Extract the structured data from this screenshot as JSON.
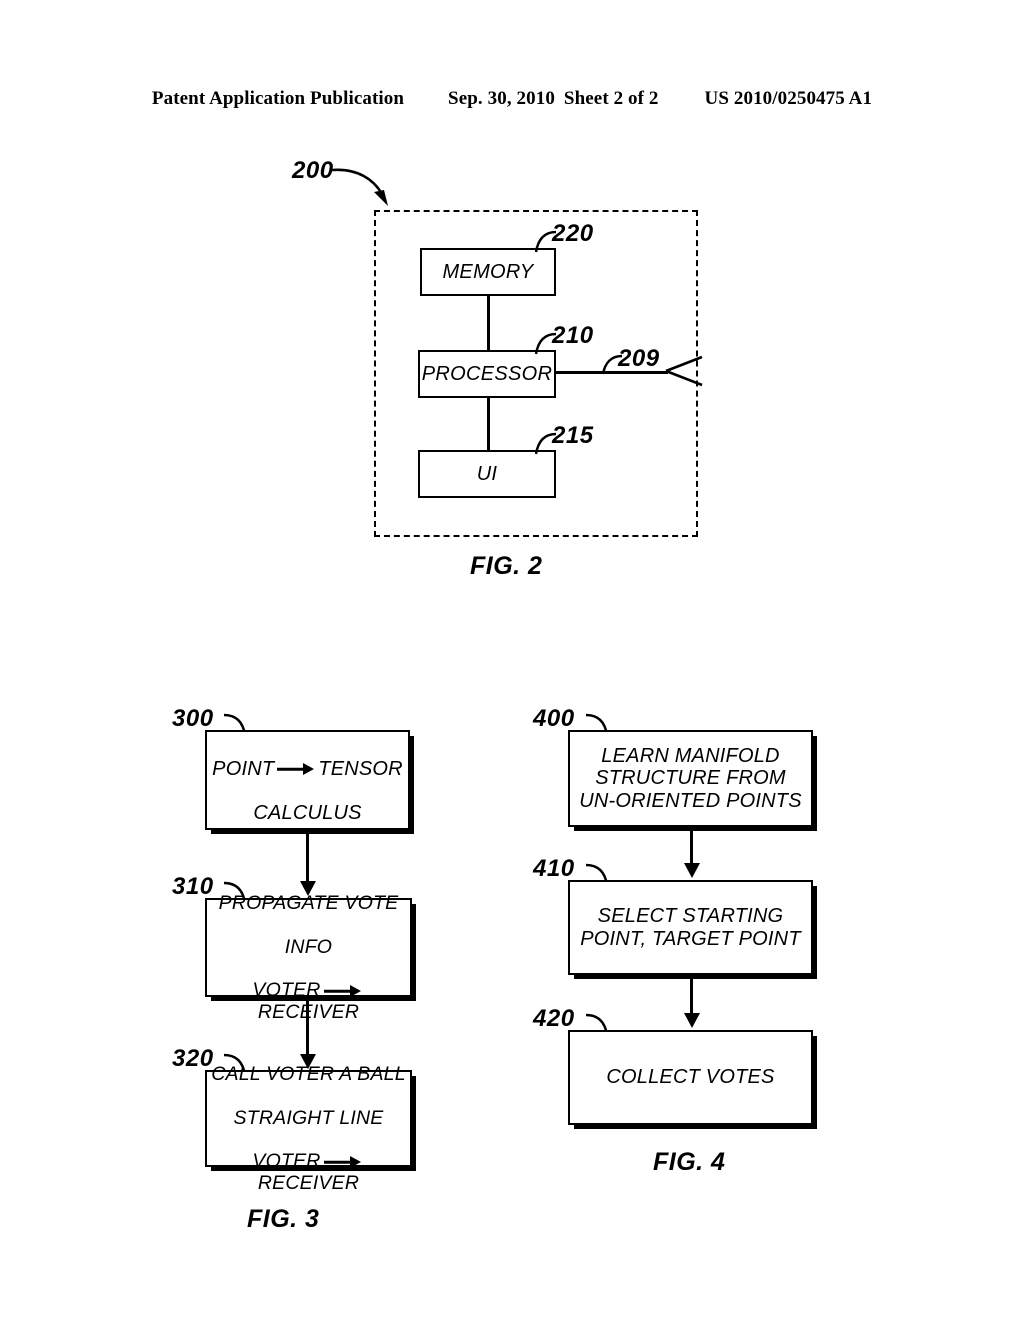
{
  "header": {
    "publication": "Patent Application Publication",
    "date": "Sep. 30, 2010",
    "sheet": "Sheet 2 of 2",
    "patent_number": "US 2010/0250475 A1"
  },
  "figures": [
    {
      "id": "fig2",
      "caption": "FIG. 2",
      "system_ref": "200",
      "blocks": [
        {
          "ref": "220",
          "label": "MEMORY"
        },
        {
          "ref": "210",
          "label": "PROCESSOR"
        },
        {
          "ref": "215",
          "label": "UI"
        }
      ],
      "connectors": [
        {
          "ref": "209",
          "type": "antenna-interface"
        }
      ]
    },
    {
      "id": "fig3",
      "caption": "FIG. 3",
      "steps": [
        {
          "ref": "300",
          "lines": [
            "POINT",
            "ARROW",
            "TENSOR",
            "BREAK",
            "CALCULUS"
          ],
          "line1_pre": "POINT",
          "line1_post": "TENSOR",
          "line2": "CALCULUS",
          "line3_pre": "",
          "line3_post": ""
        },
        {
          "ref": "310",
          "line1": "PROPAGATE VOTE",
          "line2": "INFO",
          "line3_pre": "VOTER",
          "line3_post": "RECEIVER"
        },
        {
          "ref": "320",
          "line1": "CALL VOTER A BALL",
          "line2": "STRAIGHT LINE",
          "line3_pre": "VOTER",
          "line3_post": "RECEIVER"
        }
      ]
    },
    {
      "id": "fig4",
      "caption": "FIG. 4",
      "steps": [
        {
          "ref": "400",
          "text": "LEARN MANIFOLD\nSTRUCTURE FROM\nUN-ORIENTED POINTS"
        },
        {
          "ref": "410",
          "text": "SELECT STARTING\nPOINT, TARGET POINT"
        },
        {
          "ref": "420",
          "text": "COLLECT VOTES"
        }
      ]
    }
  ],
  "colors": {
    "ink": "#000000",
    "paper": "#ffffff"
  }
}
